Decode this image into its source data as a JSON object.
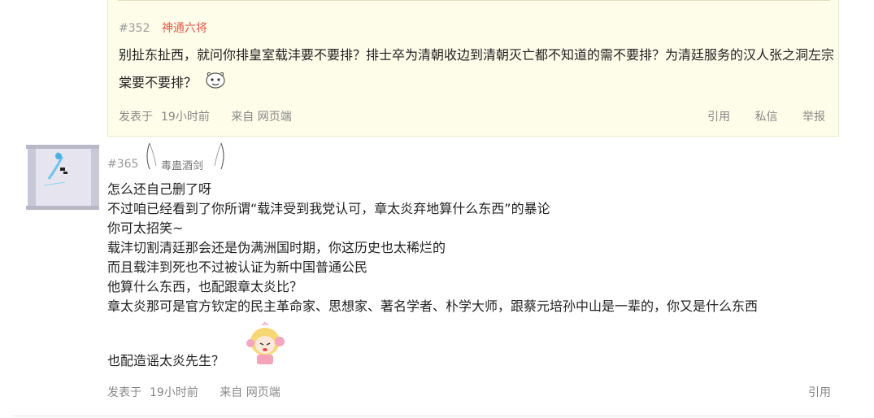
{
  "quote": {
    "floor": "#352",
    "username": "神通六将",
    "text": "别扯东扯西，就问你排皇室载沣要不要排？排士卒为清朝收边到清朝灭亡都不知道的需不要排？为清廷服务的汉人张之洞左宗棠要不要排？",
    "footer": {
      "posted_label": "发表于",
      "time": "19小时前",
      "source": "来自 网页端"
    },
    "actions": {
      "quote": "引用",
      "message": "私信",
      "report": "举报"
    }
  },
  "reply": {
    "floor": "#365",
    "badge": "毒蛊酒剑",
    "lines": [
      "怎么还自己删了呀",
      "不过咱已经看到了你所谓“载沣受到我党认可，章太炎弃地算什么东西”的暴论",
      "你可太招笑~",
      "载沣切割清廷那会还是伪满洲国时期，你这历史也太稀烂的",
      "而且载沣到死也不过被认证为新中国普通公民",
      "他算什么东西，也配跟章太炎比？",
      "章太炎那可是官方钦定的民主革命家、思想家、著名学者、朴学大师，跟蔡元培孙中山是一辈的，你又是什么东西"
    ],
    "last_line": "也配造谣太炎先生？",
    "footer": {
      "posted_label": "发表于",
      "time": "19小时前",
      "source": "来自 网页端"
    },
    "actions": {
      "quote": "引用"
    }
  },
  "colors": {
    "quote_bg": "#fefde9",
    "username": "#e45b4b",
    "muted": "#888888"
  }
}
